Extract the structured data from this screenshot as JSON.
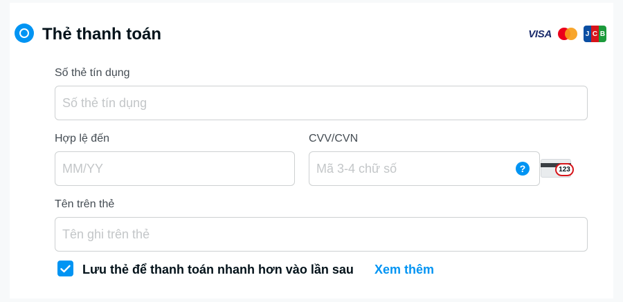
{
  "section": {
    "title": "Thẻ thanh toán",
    "brands": {
      "visa": "VISA",
      "jcb": [
        "J",
        "C",
        "B"
      ]
    }
  },
  "card_number": {
    "label": "Số thẻ tín dụng",
    "placeholder": "Số thẻ tín dụng",
    "value": ""
  },
  "expiry": {
    "label": "Hợp lệ đến",
    "placeholder": "MM/YY",
    "value": ""
  },
  "cvv": {
    "label": "CVV/CVN",
    "placeholder": "Mã 3-4 chữ số",
    "value": "",
    "help_glyph": "?",
    "card_hint": "123"
  },
  "holder_name": {
    "label": "Tên trên thẻ",
    "placeholder": "Tên ghi trên thẻ",
    "value": ""
  },
  "save_card": {
    "checked": true,
    "text": "Lưu thẻ để thanh toán nhanh hơn vào lần sau",
    "link": "Xem thêm"
  },
  "colors": {
    "accent": "#0194f3",
    "text": "#03121a",
    "label": "#434b52",
    "border": "#cdd0d1",
    "placeholder": "#c3c6c8"
  }
}
